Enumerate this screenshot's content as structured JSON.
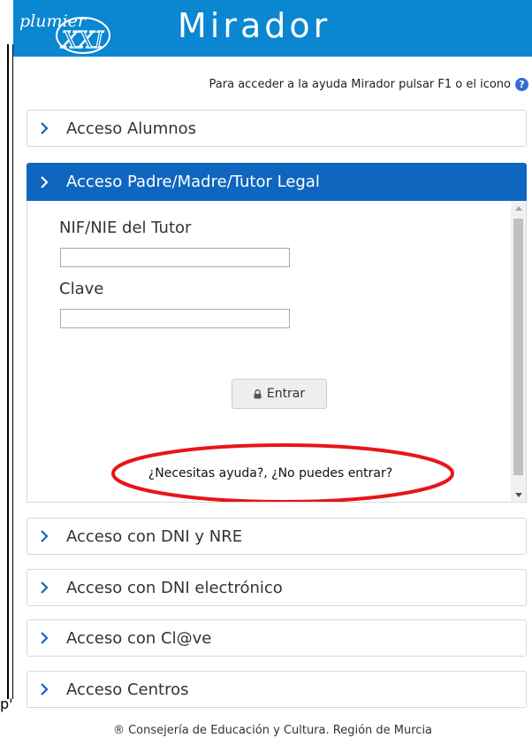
{
  "header": {
    "title": "Mirador",
    "logo_text": "plumier XXI"
  },
  "help_line": {
    "text": "Para acceder a la ayuda Mirador pulsar F1 o el icono",
    "icon": "question-circle-icon",
    "icon_glyph": "?"
  },
  "accordion": [
    {
      "label": "Acceso Alumnos"
    },
    {
      "label": "Acceso Padre/Madre/Tutor Legal"
    },
    {
      "label": "Acceso con DNI y NRE"
    },
    {
      "label": "Acceso con DNI electrónico"
    },
    {
      "label": "Acceso con Cl@ve"
    },
    {
      "label": "Acceso Centros"
    }
  ],
  "login_form": {
    "nif_label": "NIF/NIE del Tutor",
    "nif_value": "",
    "clave_label": "Clave",
    "clave_value": "",
    "submit_label": "Entrar",
    "submit_icon": "lock-icon",
    "help_link": "¿Necesitas ayuda?, ¿No puedes entrar?"
  },
  "footer": {
    "text": "® Consejería de Educación y Cultura. Región de Murcia"
  },
  "stray_text": "p'",
  "colors": {
    "header_bg": "#0b87d1",
    "active_tab_bg": "#0f66bf",
    "chevron": "#0f66bf",
    "annotation_red": "#e8141b"
  }
}
